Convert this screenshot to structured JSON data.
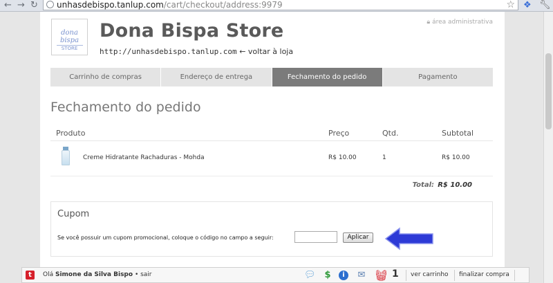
{
  "browser": {
    "url_host": "unhasdebispo.tanlup.com",
    "url_path": "/cart/checkout/address:9979"
  },
  "store": {
    "logo_top": "dona bispa",
    "logo_bottom": "STORE",
    "name": "Dona Bispa Store",
    "link_url": "http://unhasdebispo.tanlup.com",
    "link_back": "← voltar à loja",
    "admin": "área administrativa"
  },
  "tabs": [
    {
      "label": "Carrinho de compras",
      "active": false
    },
    {
      "label": "Endereço de entrega",
      "active": false
    },
    {
      "label": "Fechamento do pedido",
      "active": true
    },
    {
      "label": "Pagamento",
      "active": false
    }
  ],
  "page_title": "Fechamento do pedido",
  "table": {
    "headers": {
      "product": "Produto",
      "price": "Preço",
      "qty": "Qtd.",
      "subtotal": "Subtotal"
    },
    "rows": [
      {
        "product": "Creme Hidratante Rachaduras - Mohda",
        "price": "R$ 10.00",
        "qty": "1",
        "subtotal": "R$ 10.00"
      }
    ],
    "total_label": "Total:",
    "total_value": "R$ 10.00"
  },
  "coupon": {
    "title": "Cupom",
    "text": "Se você possuir um cupom promocional, coloque o código no campo a seguir:",
    "input_value": "",
    "button": "Aplicar"
  },
  "bottom_bar": {
    "greeting_prefix": "Olá",
    "user": "Simone da Silva Bispo",
    "logout": "• sair",
    "cart_count": "1",
    "view_cart": "ver carrinho",
    "checkout": "finalizar compra"
  },
  "colors": {
    "active_tab": "#7b7b7b",
    "arrow": "#2d3ad6",
    "brand_red": "#d6202b"
  }
}
